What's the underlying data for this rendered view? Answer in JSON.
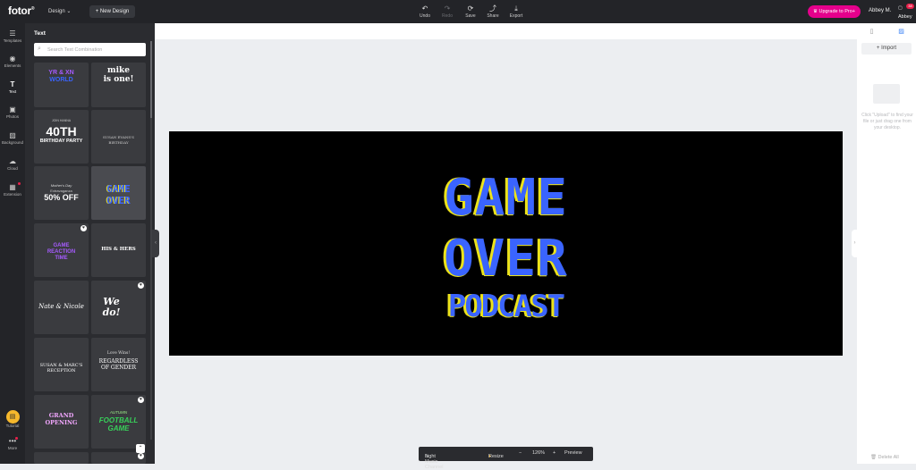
{
  "topbar": {
    "logo": "fotor",
    "design_label": "Design",
    "new_design_label": "+ New Design",
    "tools": [
      {
        "label": "Undo",
        "icon": "↶"
      },
      {
        "label": "Redo",
        "icon": "↷"
      },
      {
        "label": "Save",
        "icon": "⟳"
      },
      {
        "label": "Share",
        "icon": "⤴"
      },
      {
        "label": "Export",
        "icon": "⤓"
      }
    ],
    "upgrade_label": "Upgrade to Pro+",
    "user_name": "Abbey M.",
    "avatar_name": "Abbey",
    "notification_count": "38"
  },
  "rail": {
    "items": [
      {
        "label": "Templates",
        "icon": "☰"
      },
      {
        "label": "Elements",
        "icon": "◉"
      },
      {
        "label": "Text",
        "icon": "T"
      },
      {
        "label": "Photos",
        "icon": "▣"
      },
      {
        "label": "Background",
        "icon": "▨"
      },
      {
        "label": "Cloud",
        "icon": "☁"
      },
      {
        "label": "Extension",
        "icon": "▦"
      }
    ],
    "tutorial_label": "Tutorial",
    "more_label": "More",
    "more_icon": "•••"
  },
  "panel": {
    "title": "Text",
    "search_placeholder": "Search Text Combination",
    "search_icon": "⌕",
    "tiles": [
      {
        "lines": [
          "YR & XN",
          "WORLD"
        ]
      },
      {
        "lines": [
          "mike",
          "is one!"
        ]
      },
      {
        "lines": [
          "JOIN HANNA",
          "40TH",
          "BIRTHDAY PARTY"
        ]
      },
      {
        "lines": [
          "SUSAN EVANS'S",
          "BIRTHDAY"
        ]
      },
      {
        "lines": [
          "Mother's Day",
          "Extravaganza",
          "50% OFF"
        ]
      },
      {
        "lines": [
          "GAME",
          "OVER"
        ]
      },
      {
        "lines": [
          "GAME",
          "REACTION",
          "TIME"
        ]
      },
      {
        "lines": [
          "HIS & HERS"
        ]
      },
      {
        "lines": [
          "Nate & Nicole"
        ]
      },
      {
        "lines": [
          "We",
          "do!"
        ]
      },
      {
        "lines": [
          "SUSAN & MARC'S",
          "RECEPTION"
        ]
      },
      {
        "lines": [
          "Love Wins!",
          "REGARDLESS",
          "OF GENDER"
        ]
      },
      {
        "lines": [
          "GRAND",
          "OPENING"
        ]
      },
      {
        "lines": [
          "AUTUMN",
          "FOOTBALL",
          "GAME"
        ]
      }
    ]
  },
  "canvas": {
    "lines": [
      "GAME",
      "OVER",
      "PODCAST"
    ]
  },
  "bottombar": {
    "channel_label": "Light Music Channel",
    "resize_label": "Resize",
    "zoom_minus": "−",
    "zoom": "126%",
    "zoom_plus": "+",
    "preview_label": "Preview"
  },
  "right_panel": {
    "import_label": "+ Import",
    "upload_hint": "Click \"Upload\" to find your file or just drag one from your desktop.",
    "delete_all": "Delete All"
  },
  "colors": {
    "pixel_blue": "#3a64ff",
    "pixel_yellow": "#ece31a",
    "upgrade_pink": "#e5008c"
  }
}
